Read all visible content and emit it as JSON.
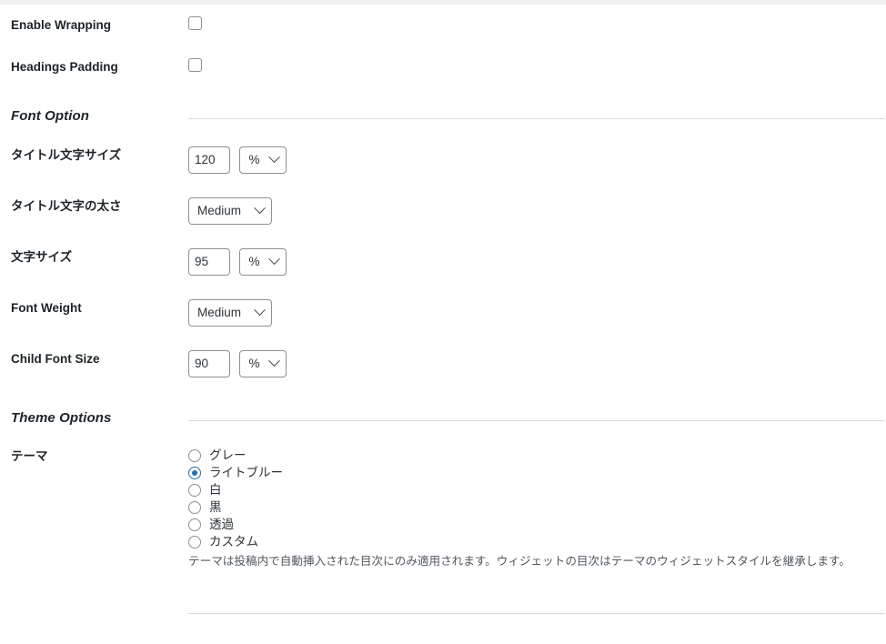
{
  "rows": {
    "enable_wrapping": {
      "label": "Enable Wrapping",
      "checked": false
    },
    "headings_padding": {
      "label": "Headings Padding",
      "checked": false
    }
  },
  "sections": {
    "font_option": {
      "title": "Font Option"
    },
    "theme_options": {
      "title": "Theme Options"
    }
  },
  "font": {
    "title_font_size": {
      "label": "タイトル文字サイズ",
      "value": "120",
      "unit": "%"
    },
    "title_font_weight": {
      "label": "タイトル文字の太さ",
      "value": "Medium"
    },
    "font_size": {
      "label": "文字サイズ",
      "value": "95",
      "unit": "%"
    },
    "font_weight": {
      "label": "Font Weight",
      "value": "Medium"
    },
    "child_font_size": {
      "label": "Child Font Size",
      "value": "90",
      "unit": "%"
    }
  },
  "theme": {
    "label": "テーマ",
    "options": [
      {
        "label": "グレー",
        "selected": false
      },
      {
        "label": "ライトブルー",
        "selected": true
      },
      {
        "label": "白",
        "selected": false
      },
      {
        "label": "黒",
        "selected": false
      },
      {
        "label": "透過",
        "selected": false
      },
      {
        "label": "カスタム",
        "selected": false
      }
    ],
    "description": "テーマは投稿内で自動挿入された目次にのみ適用されます。ウィジェットの目次はテーマのウィジェットスタイルを継承します。"
  },
  "colors": {
    "accent": "#2271b1",
    "border": "#8c8f94",
    "rule": "#dcdcde",
    "text": "#1d2327",
    "muted": "#50575e"
  }
}
